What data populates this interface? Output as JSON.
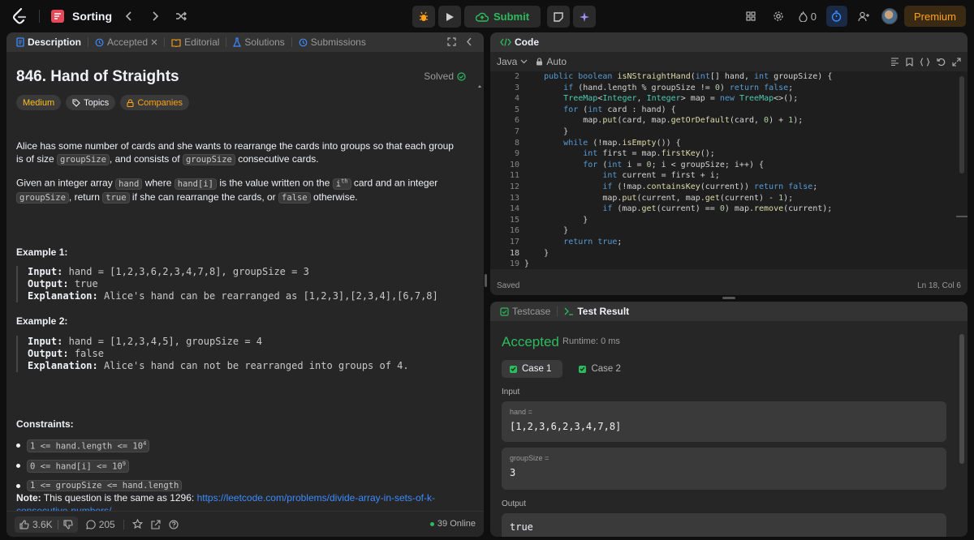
{
  "nav": {
    "problem_list": "Sorting",
    "submit_label": "Submit",
    "streak_count": "0",
    "premium_label": "Premium"
  },
  "left_tabs": [
    {
      "label": "Description"
    },
    {
      "label": "Accepted"
    },
    {
      "label": "Editorial"
    },
    {
      "label": "Solutions"
    },
    {
      "label": "Submissions"
    }
  ],
  "problem": {
    "title": "846. Hand of Straights",
    "status": "Solved",
    "difficulty": "Medium",
    "topics_label": "Topics",
    "companies_label": "Companies",
    "para1_a": "Alice has some number of cards and she wants to rearrange the cards into groups so that each group is of size ",
    "para1_code1": "groupSize",
    "para1_b": ", and consists of ",
    "para1_code2": "groupSize",
    "para1_c": " consecutive cards.",
    "para2_a": "Given an integer array ",
    "para2_code1": "hand",
    "para2_b": " where ",
    "para2_code2": "hand[i]",
    "para2_c": " is the value written on the ",
    "para2_code3": "i",
    "para2_sup": "th",
    "para2_d": " card and an integer ",
    "para2_code4": "groupSize",
    "para2_e": ", return ",
    "para2_code5": "true",
    "para2_f": " if she can rearrange the cards, or ",
    "para2_code6": "false",
    "para2_g": " otherwise.",
    "example1": {
      "heading": "Example 1:",
      "input_label": "Input:",
      "input": "hand = [1,2,3,6,2,3,4,7,8], groupSize = 3",
      "output_label": "Output:",
      "output": "true",
      "explanation_label": "Explanation:",
      "explanation": "Alice's hand can be rearranged as [1,2,3],[2,3,4],[6,7,8]"
    },
    "example2": {
      "heading": "Example 2:",
      "input_label": "Input:",
      "input": "hand = [1,2,3,4,5], groupSize = 4",
      "output_label": "Output:",
      "output": "false",
      "explanation_label": "Explanation:",
      "explanation": "Alice's hand can not be rearranged into groups of 4."
    },
    "constraints_heading": "Constraints:",
    "constraints": [
      {
        "text": "1 <= hand.length <= 10",
        "sup": "4"
      },
      {
        "text": "0 <= hand[i] <= 10",
        "sup": "9"
      },
      {
        "text": "1 <= groupSize <= hand.length",
        "sup": ""
      }
    ],
    "note_label": "Note:",
    "note_text": " This question is the same as 1296: ",
    "note_link": "https://leetcode.com/problems/divide-array-in-sets-of-k-consecutive-numbers/"
  },
  "footer": {
    "likes": "3.6K",
    "comments": "205",
    "online": "39 Online"
  },
  "code_panel": {
    "title": "Code",
    "language": "Java",
    "mode": "Auto",
    "status": "Saved",
    "cursor": "Ln 18, Col 6",
    "line_numbers": [
      "2",
      "3",
      "4",
      "5",
      "6",
      "7",
      "8",
      "9",
      "10",
      "11",
      "12",
      "13",
      "14",
      "15",
      "16",
      "17",
      "18",
      "19"
    ]
  },
  "result_panel": {
    "tab_testcase": "Testcase",
    "tab_result": "Test Result",
    "verdict": "Accepted",
    "runtime": "Runtime: 0 ms",
    "cases": [
      "Case 1",
      "Case 2"
    ],
    "input_label": "Input",
    "param1_name": "hand =",
    "param1_value": "[1,2,3,6,2,3,4,7,8]",
    "param2_name": "groupSize =",
    "param2_value": "3",
    "output_label": "Output",
    "output_value": "true"
  },
  "colors": {
    "accent_green": "#2cbb5d",
    "premium_orange": "#ffa116",
    "link_blue": "#3b8cff",
    "difficulty_medium": "#ffc01e"
  }
}
